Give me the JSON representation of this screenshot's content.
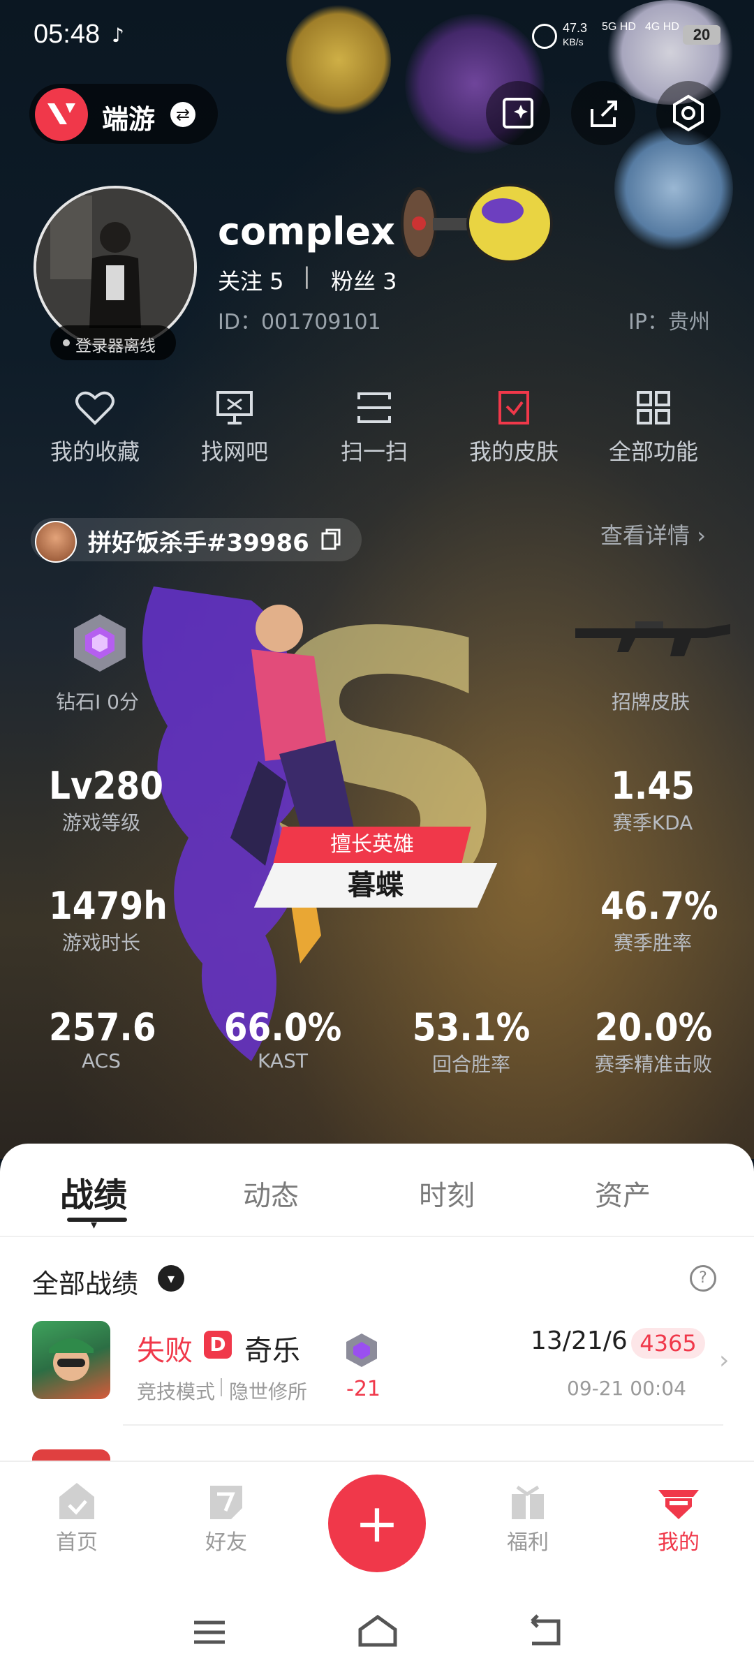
{
  "status_bar": {
    "time": "05:48",
    "network_speed": "47.3",
    "network_unit": "KB/s",
    "sig1": "5G HD",
    "sig2": "4G HD",
    "battery": "20"
  },
  "header": {
    "app_switch_label": "端游"
  },
  "profile": {
    "name": "complex",
    "follow_label": "关注 5",
    "fans_label": "粉丝 3",
    "separator": "|",
    "id_text": "ID：001709101",
    "ip_text": "IP：贵州",
    "offline_status": "登录器离线"
  },
  "quick_menu": [
    {
      "label": "我的收藏",
      "icon": "heart-icon"
    },
    {
      "label": "找网吧",
      "icon": "monitor-icon"
    },
    {
      "label": "扫一扫",
      "icon": "scan-icon"
    },
    {
      "label": "我的皮肤",
      "icon": "skin-icon"
    },
    {
      "label": "全部功能",
      "icon": "grid-icon"
    }
  ],
  "game_account": {
    "name": "拼好饭杀手#39986",
    "detail_link": "查看详情"
  },
  "game_stats": {
    "rank": "钻石I 0分",
    "signature_skin": "招牌皮肤",
    "level_val": "Lv280",
    "level_lbl": "游戏等级",
    "kda_val": "1.45",
    "kda_lbl": "赛季KDA",
    "hours_val": "1479h",
    "hours_lbl": "游戏时长",
    "winrate_val": "46.7%",
    "winrate_lbl": "赛季胜率",
    "acs_val": "257.6",
    "acs_lbl": "ACS",
    "kast_val": "66.0%",
    "kast_lbl": "KAST",
    "round_val": "53.1%",
    "round_lbl": "回合胜率",
    "precise_val": "20.0%",
    "precise_lbl": "赛季精准击败",
    "hero_tag": "擅长英雄",
    "hero_name": "暮蝶",
    "grade_letter": "S"
  },
  "tabs": [
    "战绩",
    "动态",
    "时刻",
    "资产"
  ],
  "records": {
    "filter_label": "全部战绩",
    "matches": [
      {
        "result": "失败",
        "rank_badge": "D",
        "map_agent": "奇乐",
        "mode": "竞技模式",
        "map": "隐世修所",
        "rank_change": "-21",
        "kda": "13/21/6",
        "score": "4365",
        "time": "09-21 00:04"
      }
    ]
  },
  "bottom_nav": [
    {
      "label": "首页"
    },
    {
      "label": "好友"
    },
    {
      "label": "福利"
    },
    {
      "label": "我的"
    }
  ],
  "colors": {
    "accent": "#f0384a",
    "tab_active": "#222222"
  }
}
